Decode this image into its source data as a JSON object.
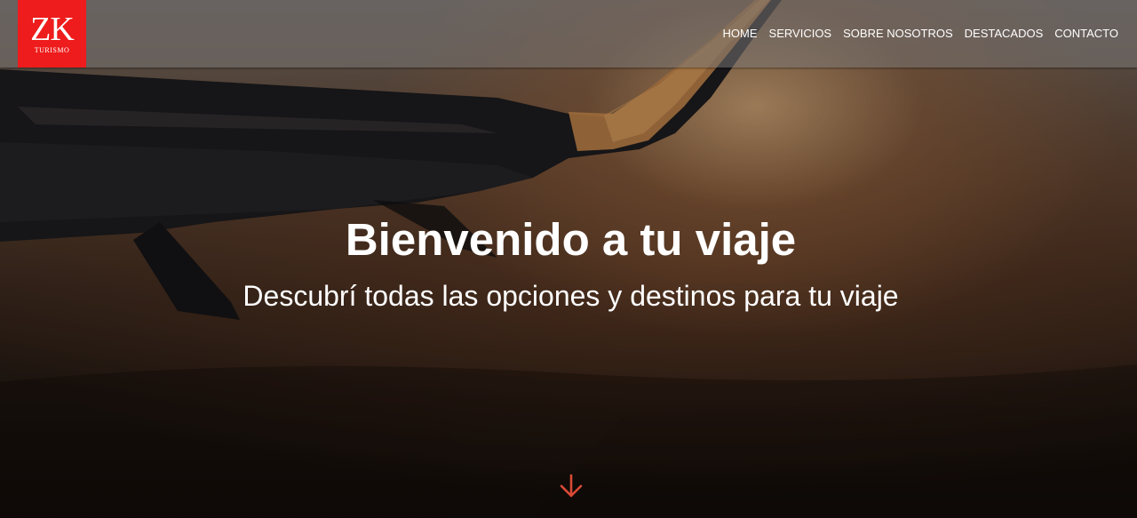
{
  "brand": {
    "logo_mark": "ZK",
    "logo_sub": "TURISMO",
    "color": "#ee1c1c"
  },
  "nav": {
    "items": [
      {
        "label": "HOME"
      },
      {
        "label": "SERVICIOS"
      },
      {
        "label": "SOBRE NOSOTROS"
      },
      {
        "label": "DESTACADOS"
      },
      {
        "label": "CONTACTO"
      }
    ]
  },
  "hero": {
    "title": "Bienvenido a tu viaje",
    "subtitle": "Descubrí todas las opciones y destinos para tu viaje",
    "background_image": "airplane-wing-at-sunset",
    "scroll_icon": "arrow-down-icon",
    "accent_color": "#d94a35"
  }
}
